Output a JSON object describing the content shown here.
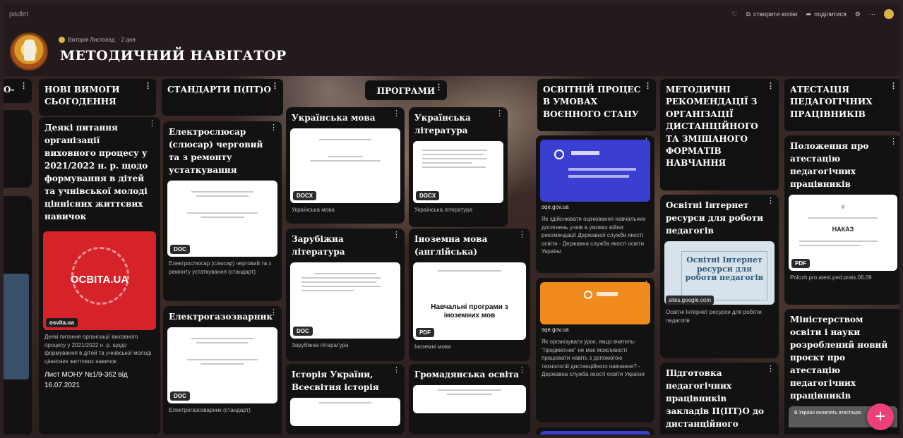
{
  "topbar": {
    "brand": "padlet",
    "remake": "створити копію",
    "share": "поділитися",
    "more": "···"
  },
  "header": {
    "author": "Вікторія Листопад",
    "time": "· 2 дня",
    "title": "МЕТОДИЧНИЙ НАВІГАТОР"
  },
  "columns": {
    "c0": "О-",
    "c1": "НОВІ ВИМОГИ СЬОГОДЕННЯ",
    "c2": "СТАНДАРТИ П(ПТ)О",
    "c3": "ПРОГРАМИ",
    "c4": "ОСВІТНІЙ ПРОЦЕС В УМОВАХ ВОЄННОГО СТАНУ",
    "c5": "МЕТОДИЧНІ РЕКОМЕНДАЦІЇ З ОРГАНІЗАЦІЇ ДИСТАНЦІЙНОГО ТА ЗМІШАНОГО ФОРМАТІВ НАВЧАННЯ",
    "c6": "АТЕСТАЦІЯ ПЕДАГОГІЧНИХ ПРАЦІВНИКІВ"
  },
  "cards": {
    "nv1": {
      "title": "Деякі питання організації виховного процесу у 2021/2022 н. р. щодо формування в дітей та учнівської молоді ціннісних життєвих навичок",
      "source": "osvita.ua",
      "logo_text": "ОСВІТА.UA",
      "desc": "Деякі питання організації виховного процесу у 2021/2022 н. р. щодо формування в дітей та учнівської молоді ціннісних життєвих навичок",
      "footer": "Лист МОНУ №1/9-362 від 16.07.2021"
    },
    "st1": {
      "title": "Електрослюсар (слюсар) черговий та з ремонту устаткування",
      "badge": "DOC",
      "desc": "Електрослюсар (слюсар) черговий та з ремонту устаткування (стандарт)"
    },
    "st2": {
      "title": "Електрогазозварник",
      "badge": "DOC",
      "desc": "Електрогазозварник (стандарт)"
    },
    "pr1": {
      "title": "Українська мова",
      "badge": "DOCX",
      "desc": "Українська мова"
    },
    "pr2": {
      "title": "Українська література",
      "badge": "DOCX",
      "desc": "Українська література"
    },
    "pr3": {
      "title": "Зарубіжна література",
      "badge": "DOC",
      "desc": "Зарубіжна література"
    },
    "pr4": {
      "title": "Іноземна мова (англійська)",
      "badge": "PDF",
      "desc": "Іноземні мови",
      "thumb_text": "Навчальні програми з іноземних мов"
    },
    "pr5": {
      "title": "Історія України, Всесвітня історія"
    },
    "pr6": {
      "title": "Громадянська освіта"
    },
    "os1": {
      "source": "sqe.gov.ua",
      "desc": "Як здійснювати оцінювання навчальних досягнень учнів в умовах війни: рекомендації Державної служби якості освіти - Державна служба якості освіти України"
    },
    "os2": {
      "source": "sqe.gov.ua",
      "desc": "Як організувати урок, якщо вчитель-\"предметник\" не має можливості працювати навіть з допомогою технологій дистанційного навчання? - Державна служба якості освіти України"
    },
    "mr1": {
      "title": "Освітні Інтернет ресурси для роботи педагогів",
      "thumb_text": "Освітні Інтернет ресурси для роботи педагогів",
      "source": "sites.google.com",
      "desc": "Освітні Інтернет ресурси для роботи педагогів"
    },
    "mr2": {
      "title": "Підготовка педагогічних працівників закладів П(ПТ)О до дистанційного"
    },
    "at1": {
      "title": "Положення про атестацію педагогічних працівників",
      "badge": "PDF",
      "thumb_text": "НАКАЗ",
      "desc": "Polozh.pro.atest.ped.prats.06.09"
    },
    "at2": {
      "title": "Міністерством освіти і науки розроблений новий проєкт про атестацію педагогічних працівників",
      "thumb_text": "В Україні оновлять атестацію"
    }
  },
  "fab": "+",
  "colors": {
    "accent": "#ef3f79",
    "sqe_blue": "#3b3fd1",
    "sqe_orange": "#f08a1c",
    "osvita_red": "#d6232a"
  }
}
